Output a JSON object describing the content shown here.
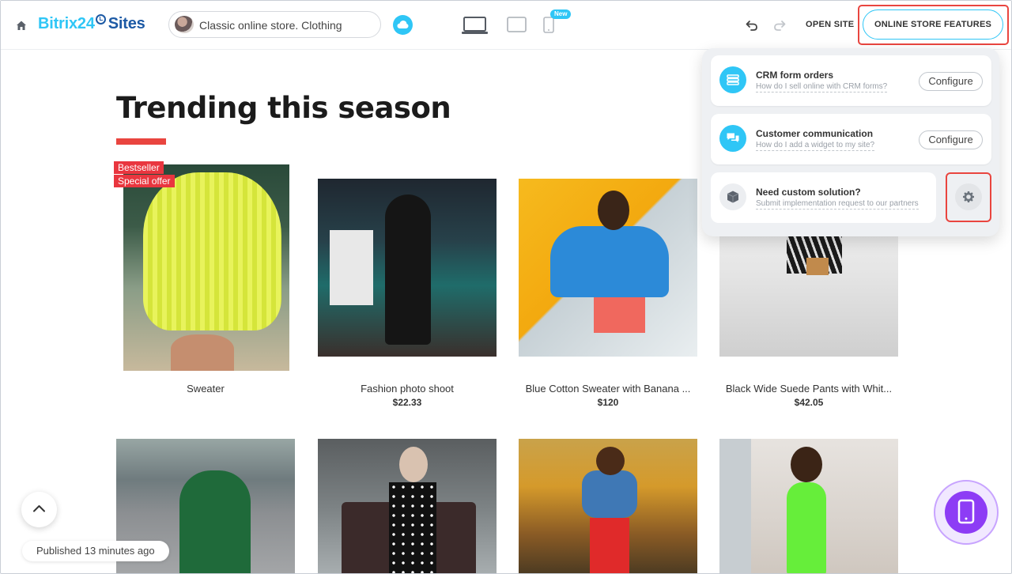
{
  "header": {
    "logo_part1": "Bitrix24",
    "logo_part2": "Sites",
    "site_select_value": "Classic online store. Clothing",
    "new_badge": "New",
    "open_site_label": "OPEN SITE",
    "features_button_label": "ONLINE STORE FEATURES"
  },
  "main": {
    "title": "Trending this season"
  },
  "products": [
    {
      "name": "Sweater",
      "price": "",
      "tags": [
        "Bestseller",
        "Special offer"
      ]
    },
    {
      "name": "Fashion photo shoot",
      "price": "$22.33",
      "tags": []
    },
    {
      "name": "Blue Cotton Sweater with Banana ...",
      "price": "$120",
      "tags": []
    },
    {
      "name": "Black Wide Suede Pants with Whit...",
      "price": "$42.05",
      "tags": []
    }
  ],
  "features_popup": {
    "items": [
      {
        "title": "CRM form orders",
        "subtitle": "How do I sell online with CRM forms?",
        "button": "Configure",
        "icon": "list-icon"
      },
      {
        "title": "Customer communication",
        "subtitle": "How do I add a widget to my site?",
        "button": "Configure",
        "icon": "chat-icon"
      },
      {
        "title": "Need custom solution?",
        "subtitle": "Submit implementation request to our partners",
        "icon": "box-icon"
      }
    ],
    "gear_icon": "gear-icon"
  },
  "footer": {
    "published_text": "Published 13 minutes ago"
  },
  "colors": {
    "accent": "#2fc6f6",
    "highlight": "#e9453f",
    "title_underline": "#e9453f",
    "mobile_preview": "#8d3cf5"
  }
}
